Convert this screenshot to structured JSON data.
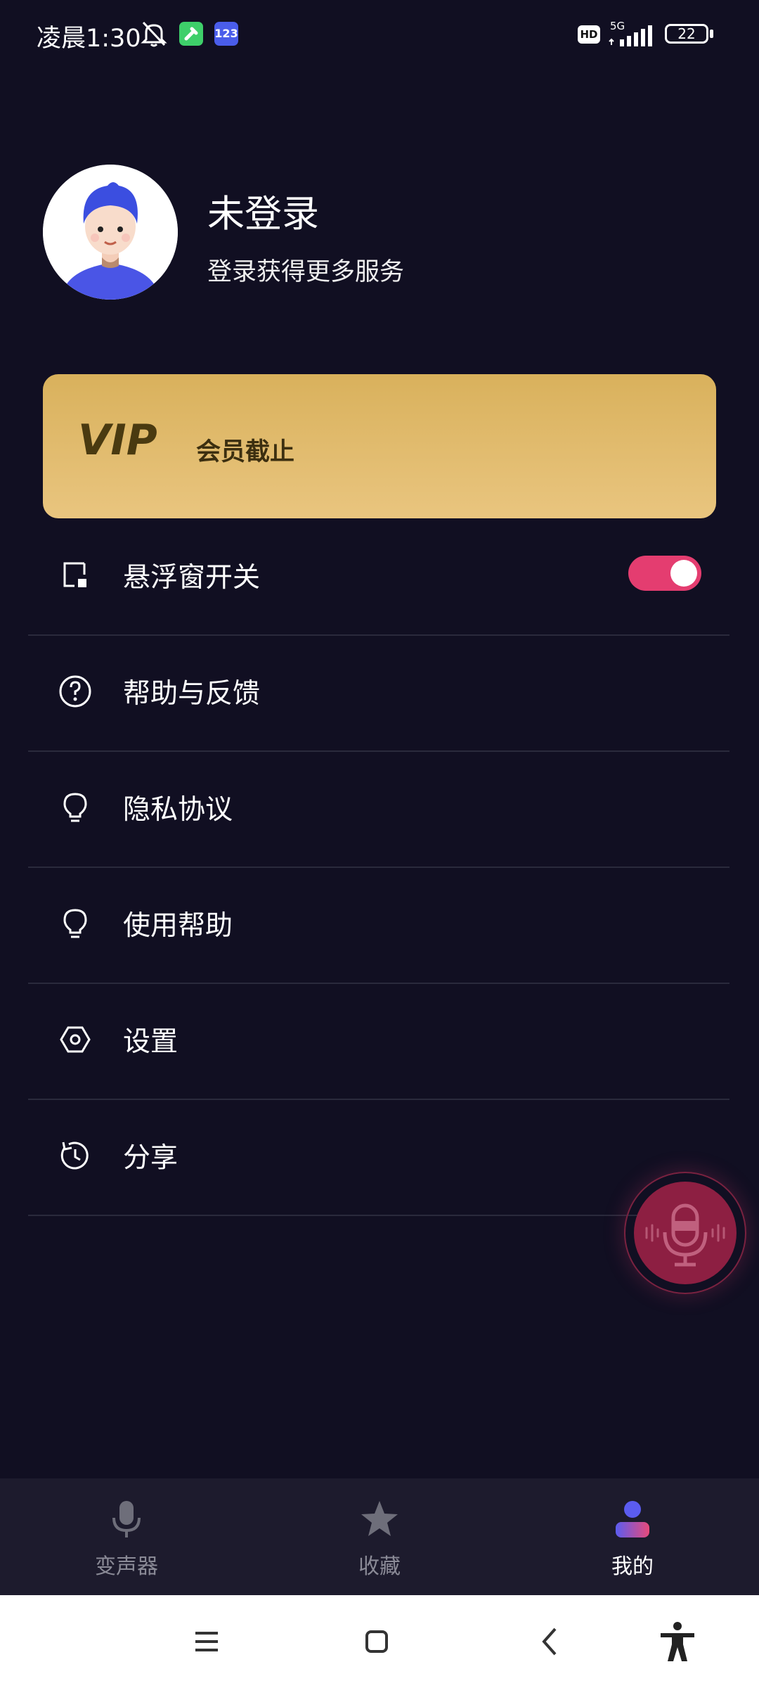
{
  "status_bar": {
    "time": "凌晨1:30",
    "app2_label": "123",
    "hd_label": "HD",
    "network": "5G",
    "battery": "22"
  },
  "profile": {
    "name": "未登录",
    "subtitle": "登录获得更多服务"
  },
  "vip": {
    "logo_text": "VIP",
    "text": "会员截止"
  },
  "menu": [
    {
      "label": "悬浮窗开关",
      "icon": "floating-window-icon"
    },
    {
      "label": "帮助与反馈",
      "icon": "help-icon"
    },
    {
      "label": "隐私协议",
      "icon": "lightbulb-icon"
    },
    {
      "label": "使用帮助",
      "icon": "lightbulb-icon"
    },
    {
      "label": "设置",
      "icon": "settings-icon"
    },
    {
      "label": "分享",
      "icon": "share-icon"
    }
  ],
  "toggle_on": true,
  "tabs": [
    {
      "label": "变声器",
      "icon": "microphone-icon"
    },
    {
      "label": "收藏",
      "icon": "star-icon"
    },
    {
      "label": "我的",
      "icon": "profile-icon"
    }
  ],
  "colors": {
    "background": "#110f22",
    "accent": "#e43d70",
    "vip_gold": "#d9b15c",
    "tab_bar": "#1d1b2d"
  }
}
